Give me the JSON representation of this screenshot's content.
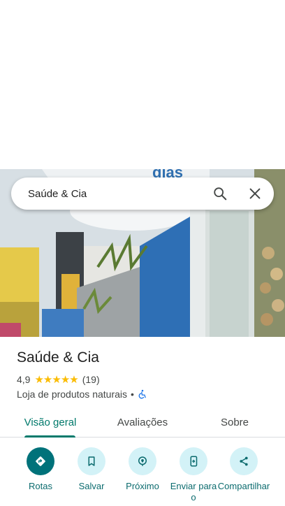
{
  "search": {
    "value": "Saúde & Cia"
  },
  "photo": {
    "sign_text": "dias"
  },
  "place": {
    "name": "Saúde & Cia",
    "rating": "4,9",
    "stars": 5,
    "review_count": "(19)",
    "category": "Loja de produtos naturais",
    "separator": "•"
  },
  "tabs": [
    {
      "label": "Visão geral",
      "active": true
    },
    {
      "label": "Avaliações",
      "active": false
    },
    {
      "label": "Sobre",
      "active": false
    }
  ],
  "actions": [
    {
      "label": "Rotas",
      "icon": "directions-icon"
    },
    {
      "label": "Salvar",
      "icon": "bookmark-icon"
    },
    {
      "label": "Próximo",
      "icon": "nearby-icon"
    },
    {
      "label": "Enviar para o",
      "icon": "send-to-phone-icon"
    },
    {
      "label": "Compartilhar",
      "icon": "share-icon"
    }
  ],
  "colors": {
    "accent": "#00796b",
    "star": "#fbbc04",
    "action_bg": "#d3f2f7",
    "primary_action_bg": "#00727a"
  }
}
